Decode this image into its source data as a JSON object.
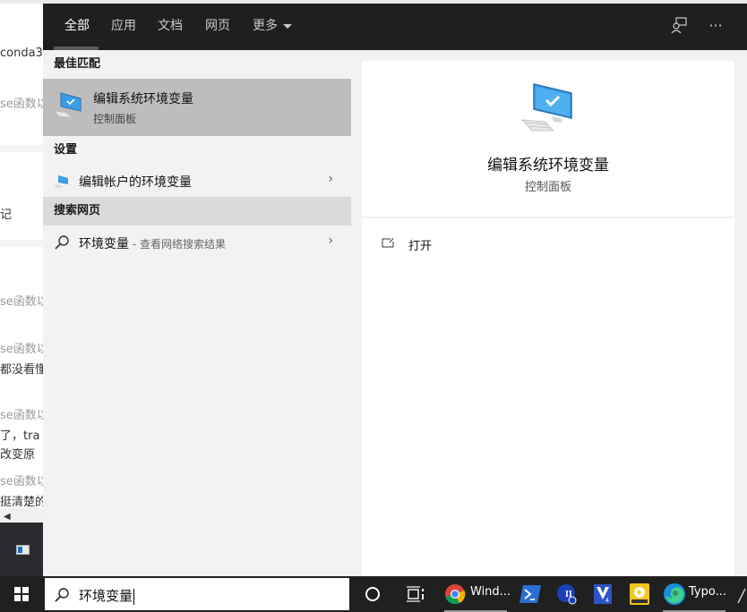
{
  "background_page": {
    "fragments": [
      {
        "text": "conda3",
        "gray": false
      },
      {
        "text": "se函数以",
        "gray": true
      },
      {
        "text": "记",
        "gray": false
      },
      {
        "text": "se函数以",
        "gray": true
      },
      {
        "text": "se函数以",
        "gray": true
      },
      {
        "text": "都没看懂",
        "gray": false
      },
      {
        "text": "se函数以",
        "gray": true
      },
      {
        "text": "了，tra",
        "gray": false
      },
      {
        "text": "改变原",
        "gray": false
      },
      {
        "text": "se函数以",
        "gray": true
      },
      {
        "text": "挺清楚的",
        "gray": false
      }
    ]
  },
  "search_menu": {
    "tabs": [
      {
        "label": "全部",
        "active": true
      },
      {
        "label": "应用",
        "active": false
      },
      {
        "label": "文档",
        "active": false
      },
      {
        "label": "网页",
        "active": false
      },
      {
        "label": "更多",
        "active": false
      }
    ],
    "header_icons": [
      "feedback-icon",
      "more-options-icon"
    ],
    "more_options_glyph": "···",
    "sections": {
      "best_match": {
        "label": "最佳匹配",
        "item": {
          "title": "编辑系统环境变量",
          "subtitle": "控制面板",
          "icon": "computer-check-icon"
        }
      },
      "settings": {
        "label": "设置",
        "items": [
          {
            "title": "编辑帐户的环境变量",
            "icon": "computer-check-icon",
            "chevron": "›"
          }
        ]
      },
      "web": {
        "label": "搜索网页",
        "items": [
          {
            "title": "环境变量",
            "suffix": " - 查看网络搜索结果",
            "icon": "search-icon",
            "chevron": "›"
          }
        ]
      }
    },
    "preview": {
      "title": "编辑系统环境变量",
      "subtitle": "控制面板",
      "actions": [
        {
          "label": "打开",
          "icon": "open-icon"
        }
      ]
    }
  },
  "taskbar": {
    "search": {
      "value": "环境变量"
    },
    "items": [
      {
        "name": "cortana",
        "icon": "cortana-circle-icon"
      },
      {
        "name": "task-view",
        "icon": "task-view-icon"
      },
      {
        "name": "chrome",
        "icon": "chrome-icon",
        "label": "Wind..."
      },
      {
        "name": "powershell",
        "icon": "powershell-icon"
      },
      {
        "name": "app-ii",
        "icon": "app-ii-icon"
      },
      {
        "name": "app-v4",
        "icon": "app-v4-icon"
      },
      {
        "name": "player",
        "icon": "player-icon",
        "badge": "Player"
      },
      {
        "name": "edge",
        "icon": "edge-icon",
        "label": "Typo..."
      }
    ]
  }
}
